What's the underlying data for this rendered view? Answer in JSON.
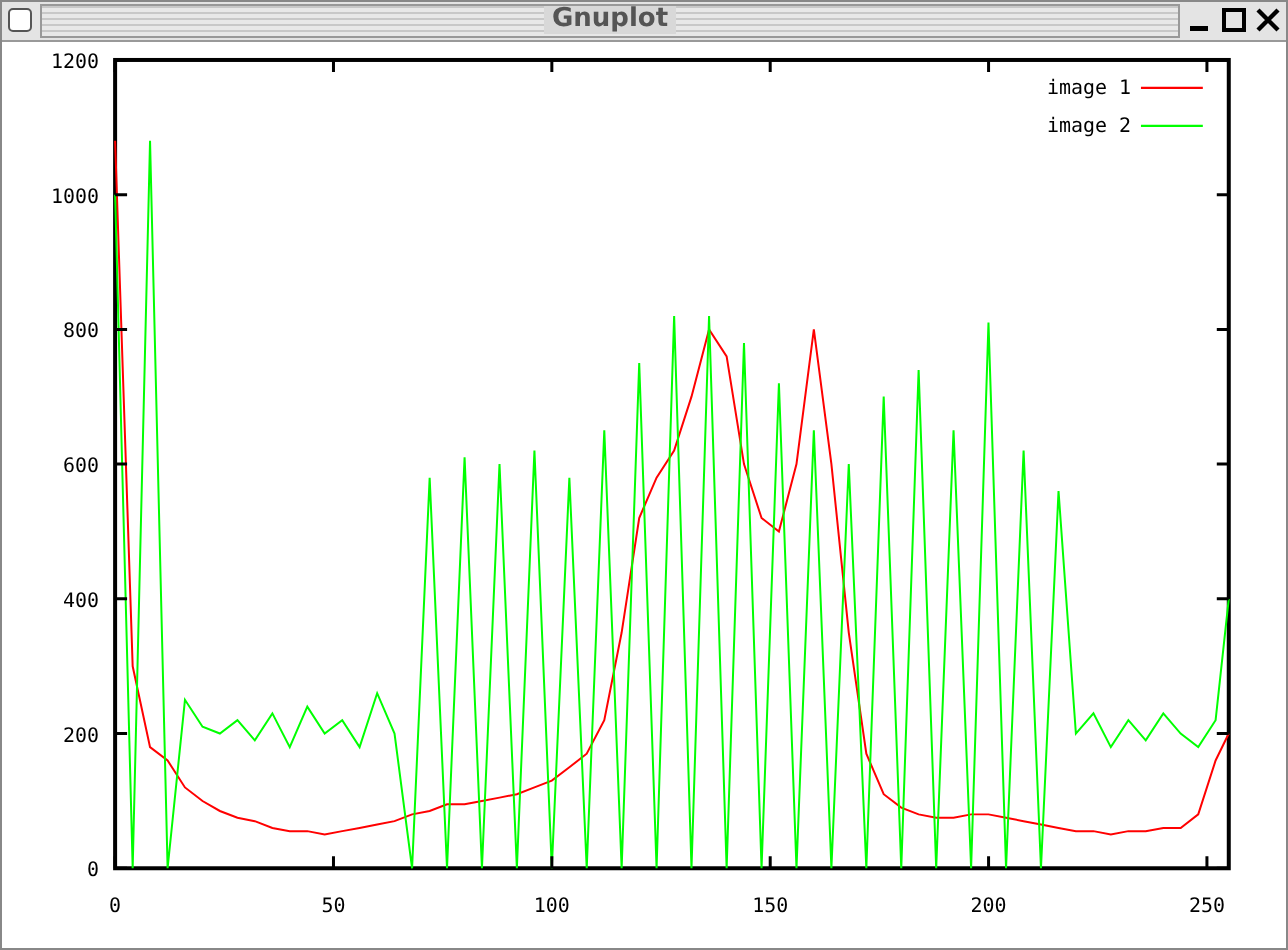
{
  "window": {
    "title": "Gnuplot"
  },
  "plot": {
    "chart_data": {
      "type": "line",
      "xlim": [
        0,
        255
      ],
      "ylim": [
        0,
        1200
      ],
      "xticks": [
        0,
        50,
        100,
        150,
        200,
        250
      ],
      "yticks": [
        0,
        200,
        400,
        600,
        800,
        1000,
        1200
      ],
      "legend": true,
      "x": [
        0,
        4,
        8,
        12,
        16,
        20,
        24,
        28,
        32,
        36,
        40,
        44,
        48,
        52,
        56,
        60,
        64,
        68,
        72,
        76,
        80,
        84,
        88,
        92,
        96,
        100,
        104,
        108,
        112,
        116,
        120,
        124,
        128,
        132,
        136,
        140,
        144,
        148,
        152,
        156,
        160,
        164,
        168,
        172,
        176,
        180,
        184,
        188,
        192,
        196,
        200,
        204,
        208,
        212,
        216,
        220,
        224,
        228,
        232,
        236,
        240,
        244,
        248,
        252,
        255
      ],
      "series": [
        {
          "name": "image 1",
          "color": "#ff0000",
          "values": [
            1080,
            300,
            180,
            160,
            120,
            100,
            85,
            75,
            70,
            60,
            55,
            55,
            50,
            55,
            60,
            65,
            70,
            80,
            85,
            95,
            95,
            100,
            105,
            110,
            120,
            130,
            150,
            170,
            220,
            350,
            520,
            580,
            620,
            700,
            800,
            760,
            600,
            520,
            500,
            600,
            800,
            600,
            350,
            170,
            110,
            90,
            80,
            75,
            75,
            80,
            80,
            75,
            70,
            65,
            60,
            55,
            55,
            50,
            55,
            55,
            60,
            60,
            80,
            160,
            200
          ]
        },
        {
          "name": "image 2",
          "color": "#00ff00",
          "values": [
            1000,
            0,
            1080,
            0,
            250,
            210,
            200,
            220,
            190,
            230,
            180,
            240,
            200,
            220,
            180,
            260,
            200,
            0,
            580,
            0,
            610,
            0,
            600,
            0,
            620,
            0,
            580,
            0,
            650,
            0,
            750,
            0,
            820,
            0,
            820,
            0,
            780,
            0,
            720,
            0,
            650,
            0,
            600,
            0,
            700,
            0,
            740,
            0,
            650,
            0,
            810,
            0,
            620,
            0,
            560,
            200,
            230,
            180,
            220,
            190,
            230,
            200,
            180,
            220,
            400
          ]
        }
      ]
    }
  }
}
